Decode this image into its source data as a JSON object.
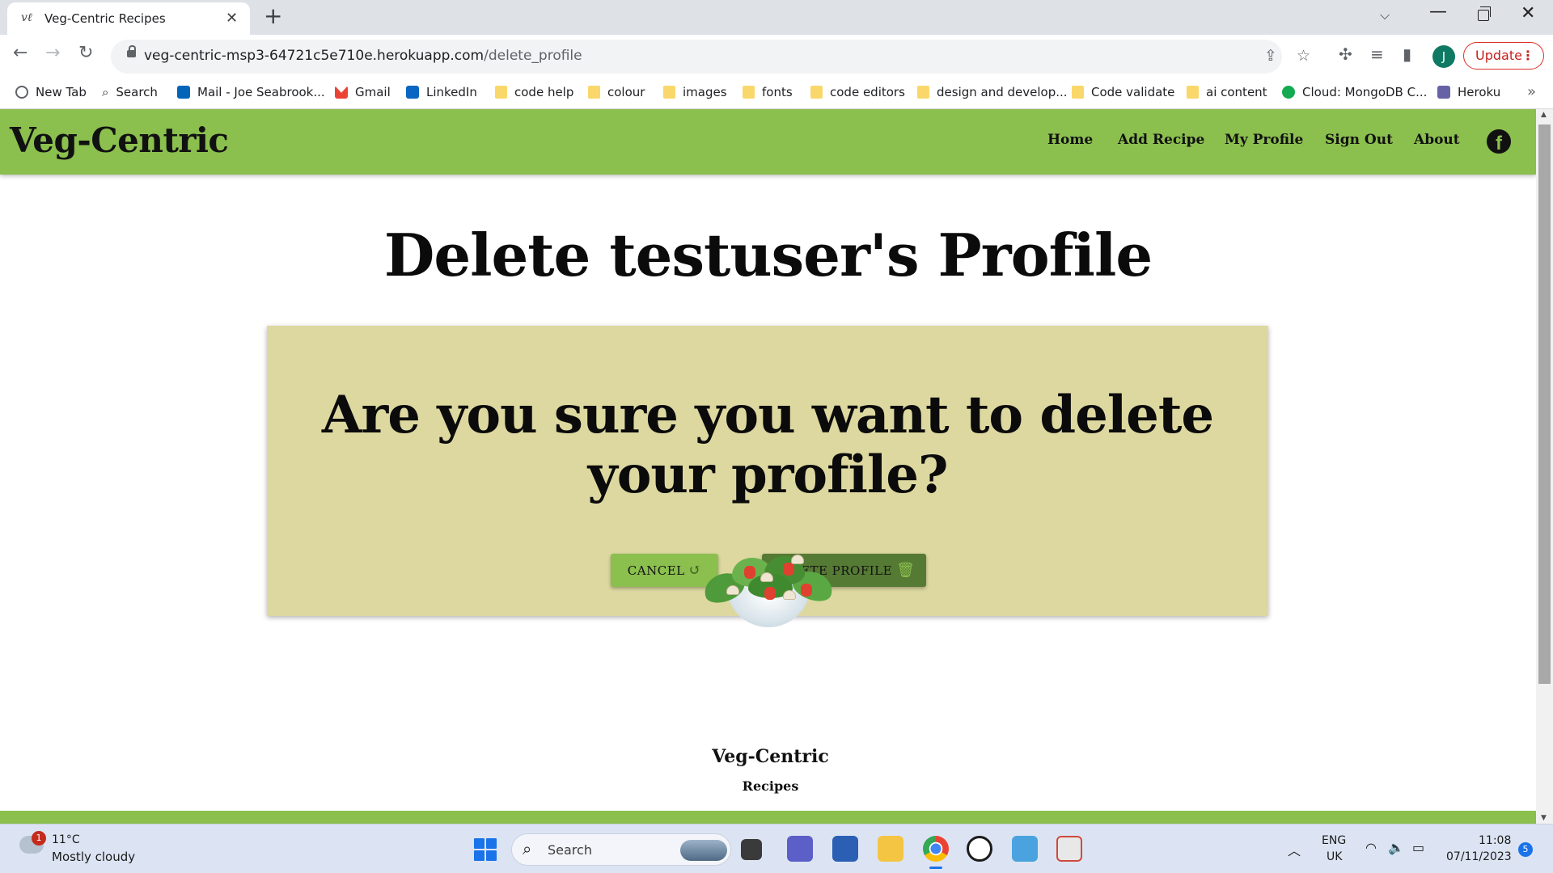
{
  "browser": {
    "tab_title": "Veg-Centric Recipes",
    "tab_favicon": "vℓ",
    "url_host": "veg-centric-msp3-64721c5e710e.herokuapp.com",
    "url_path": "/delete_profile",
    "profile_initial": "J",
    "update_label": "Update",
    "bookmarks": [
      {
        "label": "New Tab",
        "icon": "globe"
      },
      {
        "label": "Search",
        "icon": "search"
      },
      {
        "label": "Mail - Joe Seabrook...",
        "icon": "outlook"
      },
      {
        "label": "Gmail",
        "icon": "gmail"
      },
      {
        "label": "LinkedIn",
        "icon": "linkedin"
      },
      {
        "label": "code help",
        "icon": "folder"
      },
      {
        "label": "colour",
        "icon": "folder"
      },
      {
        "label": "images",
        "icon": "folder"
      },
      {
        "label": "fonts",
        "icon": "folder"
      },
      {
        "label": "code editors",
        "icon": "folder"
      },
      {
        "label": "design and develop...",
        "icon": "folder"
      },
      {
        "label": "Code validate",
        "icon": "folder"
      },
      {
        "label": "ai content",
        "icon": "folder"
      },
      {
        "label": "Cloud: MongoDB C...",
        "icon": "mongo"
      },
      {
        "label": "Heroku",
        "icon": "heroku"
      }
    ]
  },
  "site": {
    "brand": "Veg-Centric",
    "nav": [
      "Home",
      "Add Recipe",
      "My Profile",
      "Sign Out",
      "About"
    ],
    "page_title": "Delete testuser's Profile",
    "confirm_question": "Are you sure you want to delete your profile?",
    "cancel_label": "CANCEL",
    "delete_label": "DELETE PROFILE",
    "footer_logo_name": "Veg-Centric",
    "footer_logo_sub": "Recipes",
    "colors": {
      "nav_green": "#8bbf4e",
      "card_khaki": "#ddd8a0",
      "delete_dark_green": "#557a34"
    }
  },
  "taskbar": {
    "weather_badge": "1",
    "temperature": "11°C",
    "weather": "Mostly cloudy",
    "search_placeholder": "Search",
    "lang_top": "ENG",
    "lang_bottom": "UK",
    "time": "11:08",
    "date": "07/11/2023",
    "notification_count": "5"
  }
}
